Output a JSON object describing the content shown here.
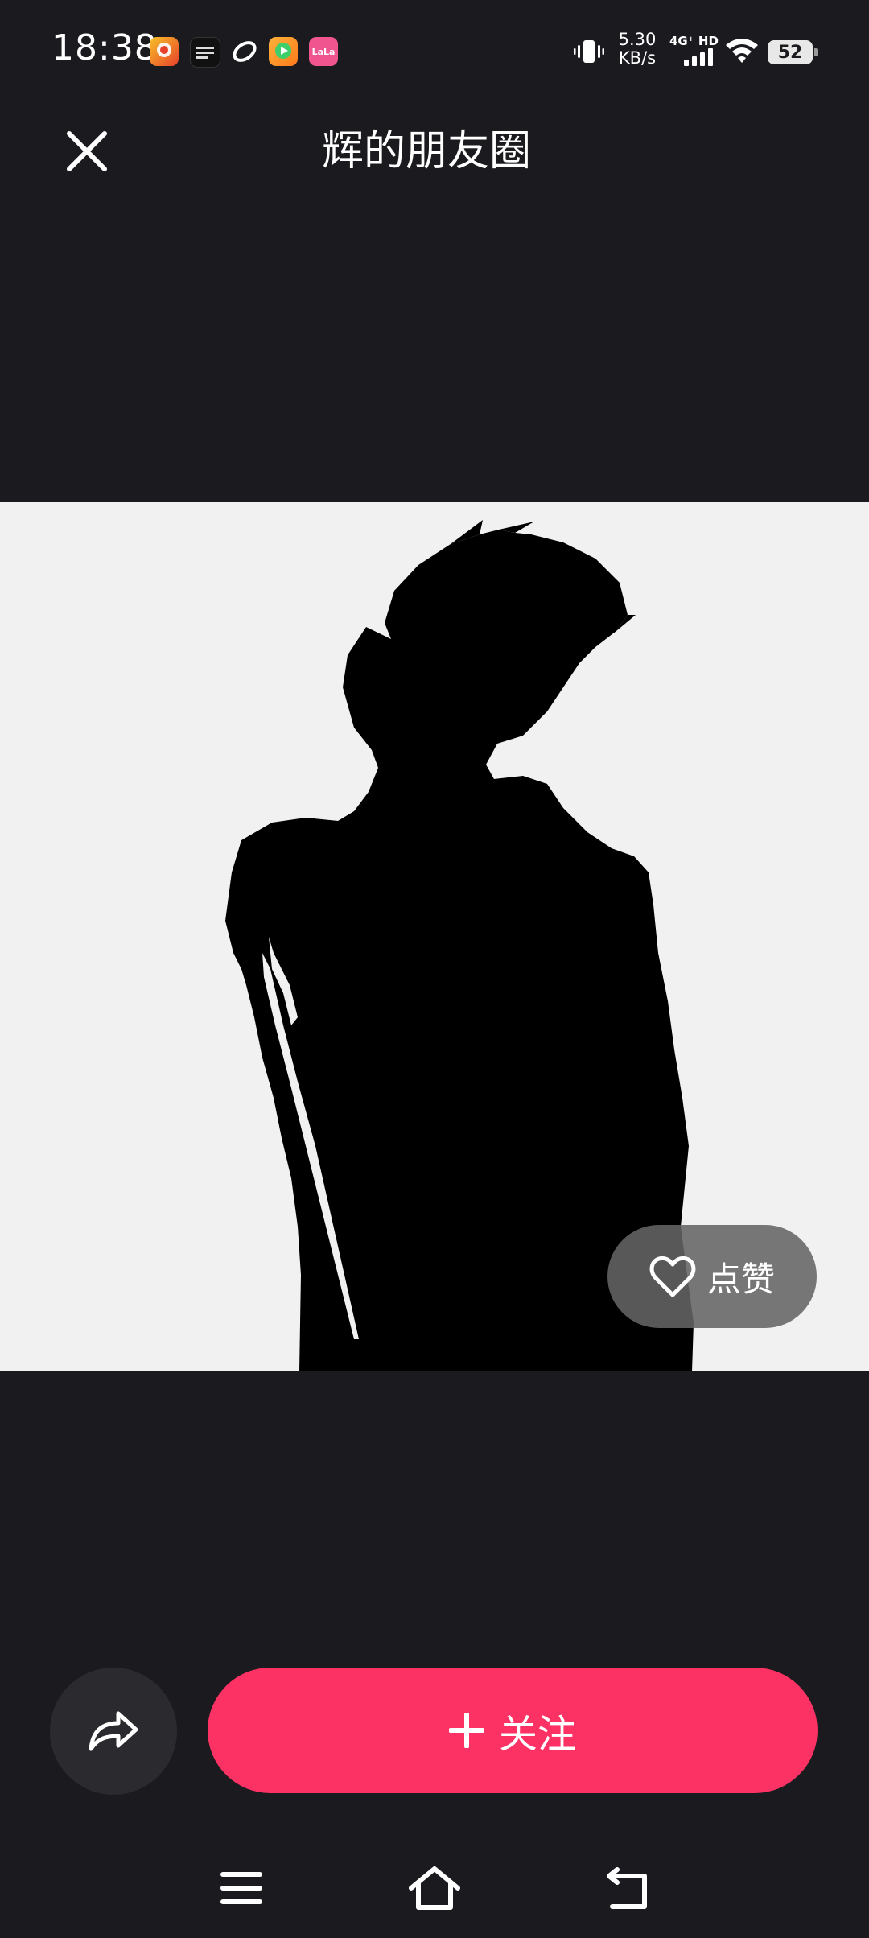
{
  "status_bar": {
    "time": "18:38",
    "net_speed_value": "5.30",
    "net_speed_unit": "KB/s",
    "signal_label": "4G⁺ HD",
    "battery": "52",
    "app_icons": [
      "app-icon-1",
      "app-icon-2",
      "app-icon-3",
      "app-icon-4",
      "app-icon-5"
    ],
    "app_icon_texts": [
      "",
      "",
      "",
      "",
      "LaLa"
    ]
  },
  "header": {
    "title": "辉的朋友圈",
    "close_icon": "close-icon"
  },
  "photo": {
    "description_icon": "silhouette-photo"
  },
  "like": {
    "label": "点赞",
    "icon": "heart-outline-icon"
  },
  "actions": {
    "share_icon": "share-arrow-icon",
    "follow_label": "关注",
    "follow_icon": "plus-icon"
  },
  "nav": {
    "menu_icon": "menu-icon",
    "home_icon": "home-icon",
    "back_icon": "back-icon"
  },
  "colors": {
    "background": "#1b1a1f",
    "follow_button": "#fd3264",
    "like_button": "#646464",
    "share_button": "#2b2a2f"
  }
}
